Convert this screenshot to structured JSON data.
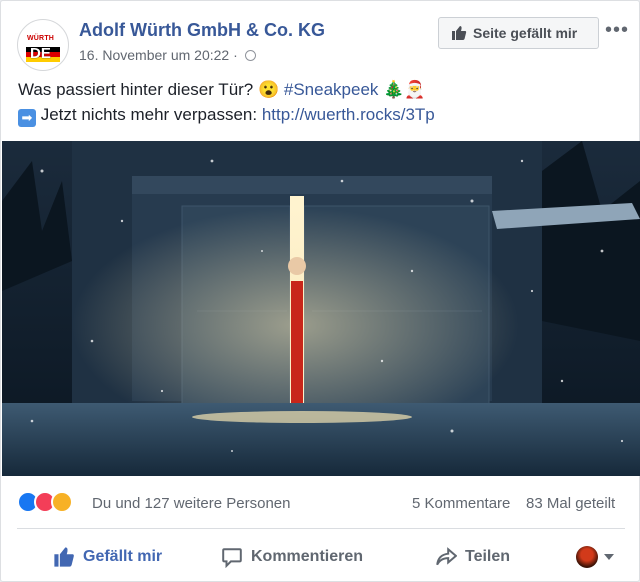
{
  "post": {
    "page_name": "Adolf Würth GmbH & Co. KG",
    "timestamp": "16. November um 20:22 ·",
    "like_page_label": "Seite gefällt mir",
    "more_label": "•••",
    "avatar": {
      "brand": "WÜRTH",
      "country": "DE"
    },
    "text_line1": {
      "before": "Was passiert hinter dieser Tür? ",
      "emoji1": "😮",
      "hashtag": " #Sneakpeek",
      "emoji2": " 🎄",
      "emoji3": "🎅"
    },
    "text_line2": {
      "arrow": "➡",
      "before": " Jetzt nichts mehr verpassen: ",
      "link": "http://wuerth.rocks/3Tp"
    }
  },
  "reactions": {
    "summary": "Du und 127 weitere Personen",
    "comments": "5 Kommentare",
    "shares": "83 Mal geteilt",
    "types": [
      "like",
      "love",
      "wow"
    ],
    "colors": {
      "like": "#1877f2",
      "love": "#f33e58",
      "wow": "#f7b125"
    }
  },
  "actions": {
    "like": "Gefällt mir",
    "comment": "Kommentieren",
    "share": "Teilen"
  },
  "colors": {
    "link": "#385898",
    "accent": "#4267b2",
    "muted": "#616770"
  }
}
